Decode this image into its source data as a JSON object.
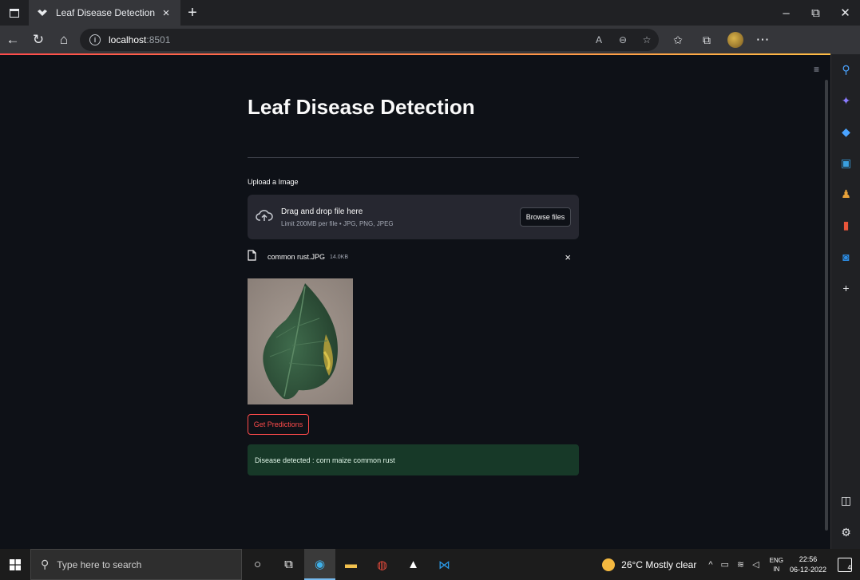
{
  "browser": {
    "tab_title": "Leaf Disease Detection",
    "new_tab": "+",
    "close_tab": "×",
    "window_controls": {
      "minimize": "–",
      "restore": "⧉",
      "close": "✕"
    },
    "url_host": "localhost",
    "url_port": ":8501"
  },
  "app": {
    "title": "Leaf Disease Detection",
    "upload_label": "Upload a Image",
    "dropzone": {
      "title": "Drag and drop file here",
      "limit": "Limit 200MB per file • JPG, PNG, JPEG",
      "browse_label": "Browse files"
    },
    "file": {
      "name": "common rust.JPG",
      "size": "14.0KB",
      "remove": "×"
    },
    "predict_label": "Get Predictions",
    "result_text": "Disease detected : corn maize common rust",
    "menu": "≡"
  },
  "taskbar": {
    "search_placeholder": "Type here to search",
    "temperature": "26°C",
    "weather": "Mostly clear",
    "lang_top": "ENG",
    "lang_bottom": "IN",
    "time": "22:56",
    "date": "06-12-2022",
    "notification_count": "4"
  },
  "colors": {
    "app_bg": "#0e1117",
    "accent": "#ff4b4b",
    "success_bg": "#173928",
    "dropzone_bg": "#262730"
  }
}
